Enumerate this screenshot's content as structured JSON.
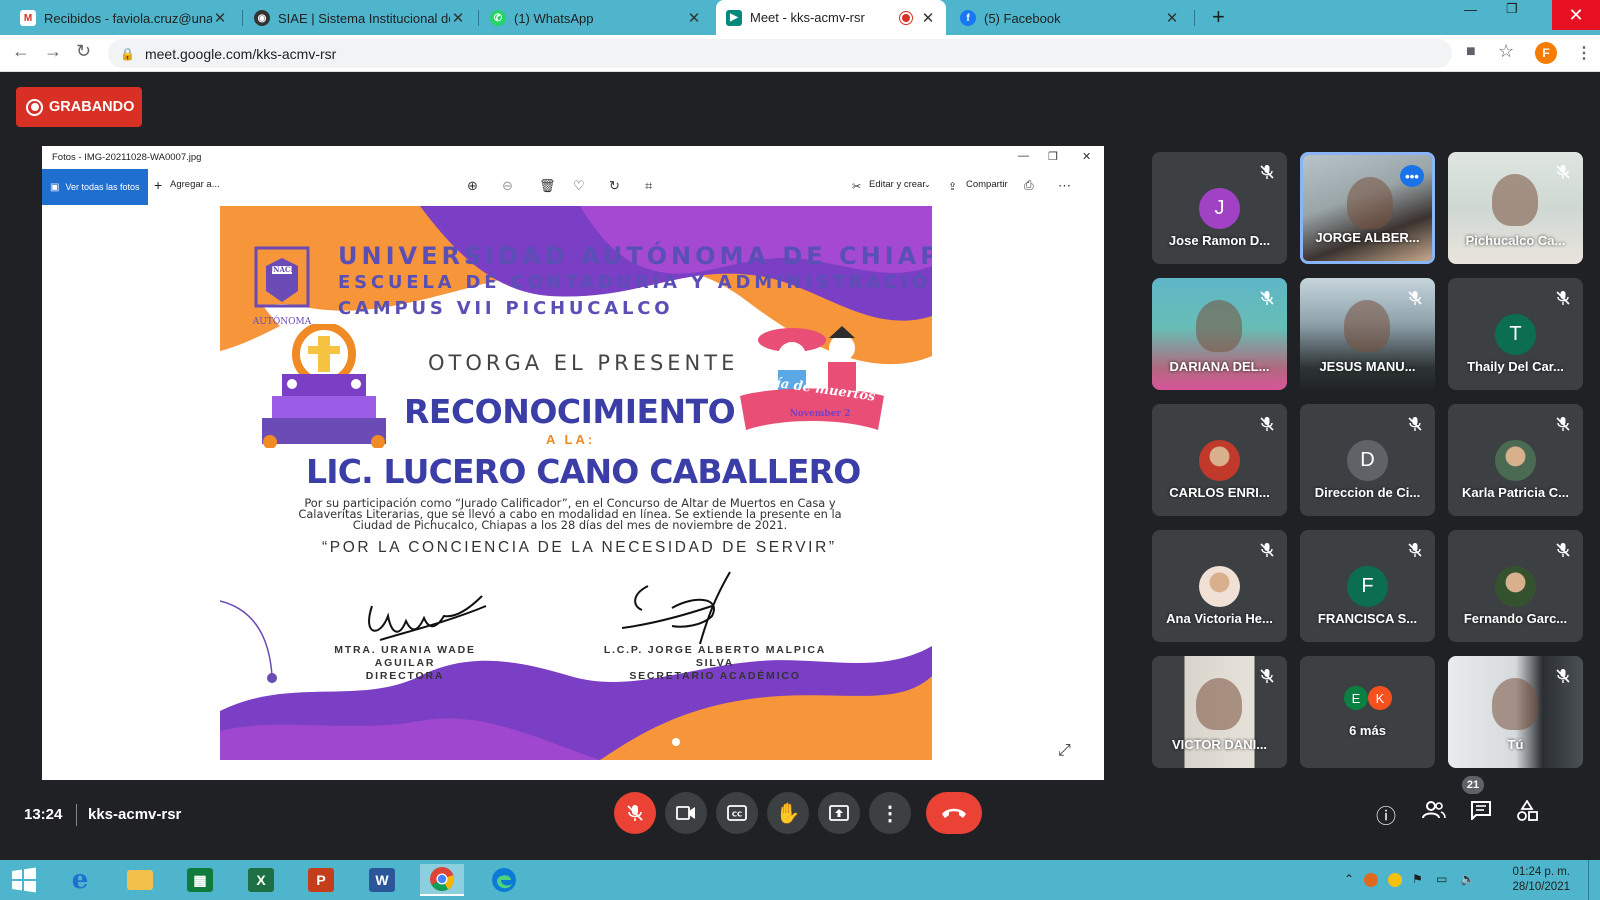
{
  "browser": {
    "tabs": [
      {
        "title": "Recibidos - faviola.cruz@unach.mx",
        "icon": "gmail-icon"
      },
      {
        "title": "SIAE | Sistema Institucional de Ad",
        "icon": "siae-icon"
      },
      {
        "title": "(1) WhatsApp",
        "icon": "whatsapp-icon"
      },
      {
        "title": "Meet - kks-acmv-rsr",
        "icon": "meet-icon"
      },
      {
        "title": "(5) Facebook",
        "icon": "facebook-icon"
      }
    ],
    "url": "meet.google.com/kks-acmv-rsr",
    "profile_initial": "F"
  },
  "recording": {
    "label": "GRABANDO"
  },
  "photos_app": {
    "title": "Fotos - IMG-20211028-WA0007.jpg",
    "see_all": "Ver todas las fotos",
    "add_to": "Agregar a...",
    "edit_create": "Editar y crear",
    "share": "Compartir"
  },
  "certificate": {
    "line1": "UNIVERSIDAD AUTÓNOMA DE CHIAPAS",
    "line2": "ESCUELA DE CONTADURÍA Y ADMINISTRACIÓN",
    "line3": "CAMPUS VII PICHUCALCO",
    "seal_top": "UNACH",
    "seal_bottom": "AUTÓNOMA",
    "otorga": "OTORGA EL PRESENTE",
    "title": "RECONOCIMIENTO",
    "a_la": "A LA:",
    "recipient": "LIC. LUCERO CANO CABALLERO",
    "body": "Por su participación como “Jurado Calificador”, en el Concurso de Altar de Muertos en Casa y Calaveritas Literarias, que se llevó a cabo en modalidad en línea. Se extiende la presente en la Ciudad de Pichucalco, Chiapas a los 28 días del mes de noviembre de 2021.",
    "motto": "“POR LA CONCIENCIA DE LA NECESIDAD DE SERVIR”",
    "banner": "Día de muertos",
    "banner_date": "November 2",
    "sig1_name": "MTRA. URANIA WADE AGUILAR",
    "sig1_role": "DIRECTORA",
    "sig2_name": "L.C.P. JORGE ALBERTO MALPICA SILVA",
    "sig2_role": "SECRETARIO ACADÉMICO"
  },
  "participants": [
    {
      "name": "Jose Ramon D...",
      "initial": "J",
      "color": "#a142c4",
      "type": "avatar"
    },
    {
      "name": "JORGE ALBER...",
      "type": "video",
      "speaking": true
    },
    {
      "name": "Pichucalco Ca...",
      "type": "video"
    },
    {
      "name": "DARIANA DEL...",
      "type": "video"
    },
    {
      "name": "JESUS MANU...",
      "type": "video"
    },
    {
      "name": "Thaily Del Car...",
      "initial": "T",
      "color": "#0b6e4f",
      "type": "avatar"
    },
    {
      "name": "CARLOS ENRI...",
      "type": "photo"
    },
    {
      "name": "Direccion de Ci...",
      "initial": "D",
      "color": "#5f6368",
      "type": "avatar"
    },
    {
      "name": "Karla Patricia C...",
      "type": "photo"
    },
    {
      "name": "Ana Victoria He...",
      "type": "photo"
    },
    {
      "name": "FRANCISCA S...",
      "initial": "F",
      "color": "#0b6e4f",
      "type": "avatar"
    },
    {
      "name": "Fernando Garc...",
      "type": "photo"
    },
    {
      "name": "VICTOR DANI...",
      "type": "video"
    },
    {
      "name": "6 más",
      "type": "more",
      "initials": [
        "E",
        "K"
      ]
    },
    {
      "name": "Tú",
      "type": "video"
    }
  ],
  "meeting": {
    "time": "13:24",
    "code": "kks-acmv-rsr",
    "participant_count": "21"
  },
  "taskbar": {
    "time": "01:24 p. m.",
    "date": "28/10/2021"
  }
}
